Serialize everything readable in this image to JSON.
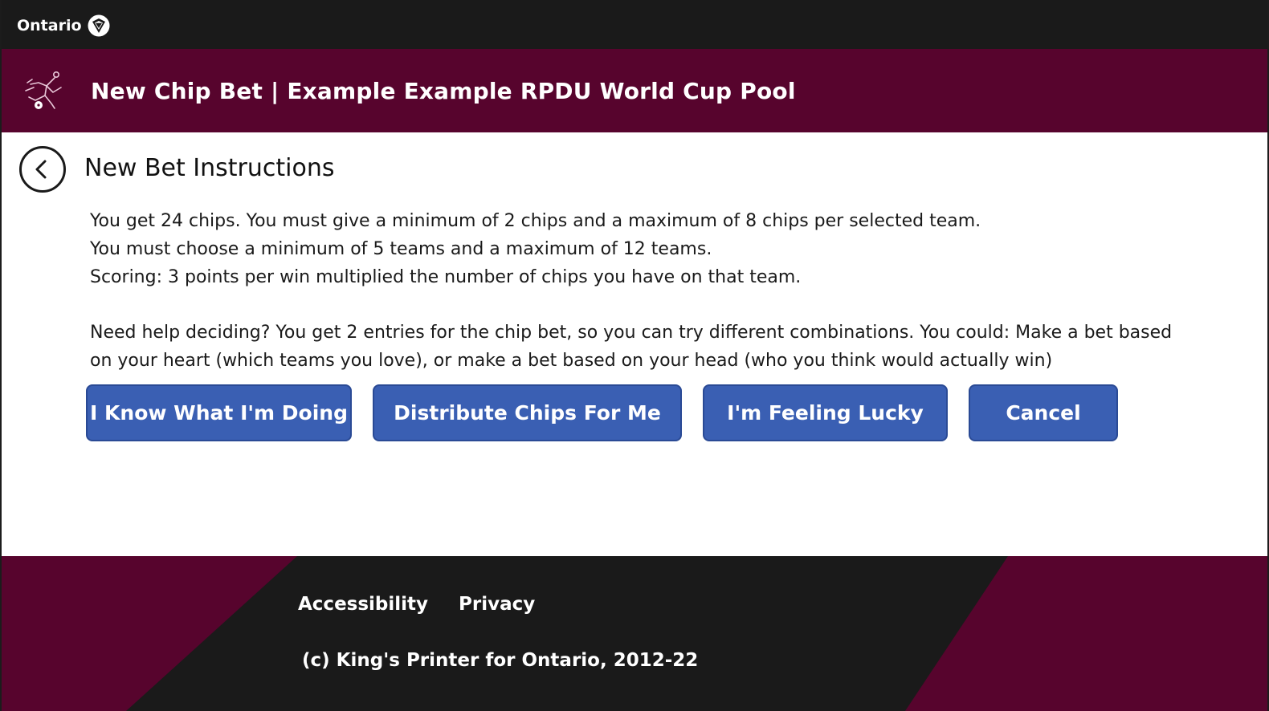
{
  "topbar": {
    "brand": "Ontario"
  },
  "header": {
    "title": "New Chip Bet | Example Example RPDU World Cup Pool"
  },
  "main": {
    "section_title": "New Bet Instructions",
    "instructions": [
      "You get 24 chips. You must give a minimum of 2 chips and a maximum of 8 chips per selected team.",
      "You must choose a minimum of 5 teams and a maximum of 12 teams.",
      "Scoring: 3 points per win multiplied the number of chips you have on that team."
    ],
    "help_text": "Need help deciding? You get 2 entries for the chip bet, so you can try different combinations. You could: Make a bet based on your heart (which teams you love), or make a bet based on your head (who you think would actually win)",
    "buttons": [
      {
        "label": "I Know What I'm Doing"
      },
      {
        "label": "Distribute Chips For Me"
      },
      {
        "label": "I'm Feeling Lucky"
      },
      {
        "label": "Cancel"
      }
    ]
  },
  "footer": {
    "links": [
      {
        "label": "Accessibility"
      },
      {
        "label": "Privacy"
      }
    ],
    "copyright": "(c) King's Printer for Ontario, 2012-22"
  },
  "colors": {
    "topbar_bg": "#1a1a1a",
    "header_bg": "#57042d",
    "button_bg": "#3a5fb3",
    "footer_dark": "#1a1a1a",
    "footer_accent": "#57042d"
  },
  "icons": {
    "brand": "ontario-trillium-icon",
    "app": "soccer-player-icon",
    "back": "back-arrow-icon"
  }
}
